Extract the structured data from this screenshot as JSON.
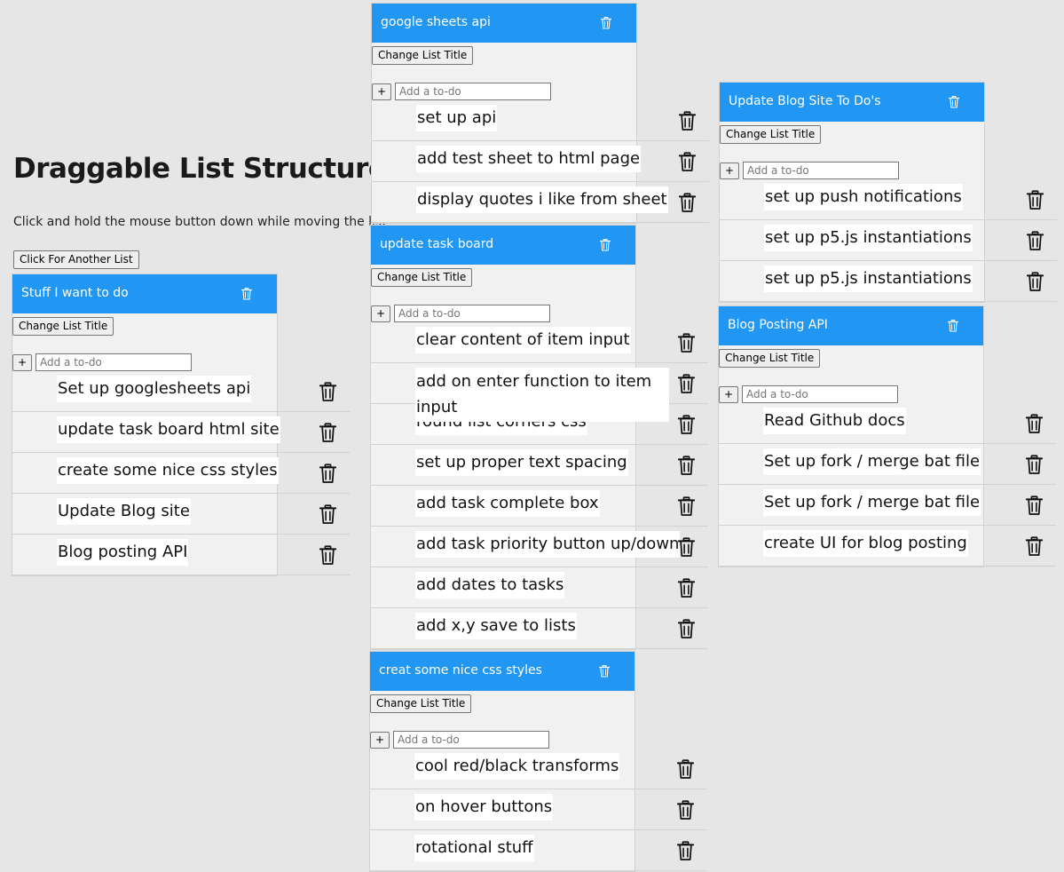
{
  "page": {
    "title": "Draggable List Structures",
    "instructions": "Click and hold the mouse button down while moving the list",
    "new_list_button": "Click For Another List"
  },
  "common": {
    "change_title_label": "Change List Title",
    "add_label": "+",
    "add_placeholder": "Add a to-do"
  },
  "colors": {
    "header": "#2196f3",
    "list_bg": "#f1f1f1",
    "page_bg": "#e6e6e6"
  },
  "icons": {
    "delete": "trash-icon"
  },
  "lists": [
    {
      "title": "Stuff I want to do",
      "items": [
        "Set up googlesheets api",
        "update task board html site",
        "create some nice css styles",
        "Update Blog site",
        "Blog posting API"
      ]
    },
    {
      "title": "google sheets api",
      "items": [
        "set up api",
        "add test sheet to html page",
        "display quotes i like from sheet"
      ]
    },
    {
      "title": "update task board",
      "items": [
        "clear content of item input",
        "add on enter function to item input",
        "round list corners css",
        "set up proper text spacing",
        "add task complete box",
        "add task priority button up/down",
        "add dates to tasks",
        "add x,y save to lists"
      ]
    },
    {
      "title": "creat some nice css styles",
      "items": [
        "cool red/black transforms",
        "on hover buttons",
        "rotational stuff"
      ]
    },
    {
      "title": "Update Blog Site To Do's",
      "items": [
        "set up push notifications",
        "set up p5.js instantiations",
        "set up p5.js instantiations"
      ]
    },
    {
      "title": "Blog Posting API",
      "items": [
        "Read Github docs",
        "Set up fork / merge bat file",
        "Set up fork / merge bat file",
        "create UI for blog posting"
      ]
    }
  ]
}
